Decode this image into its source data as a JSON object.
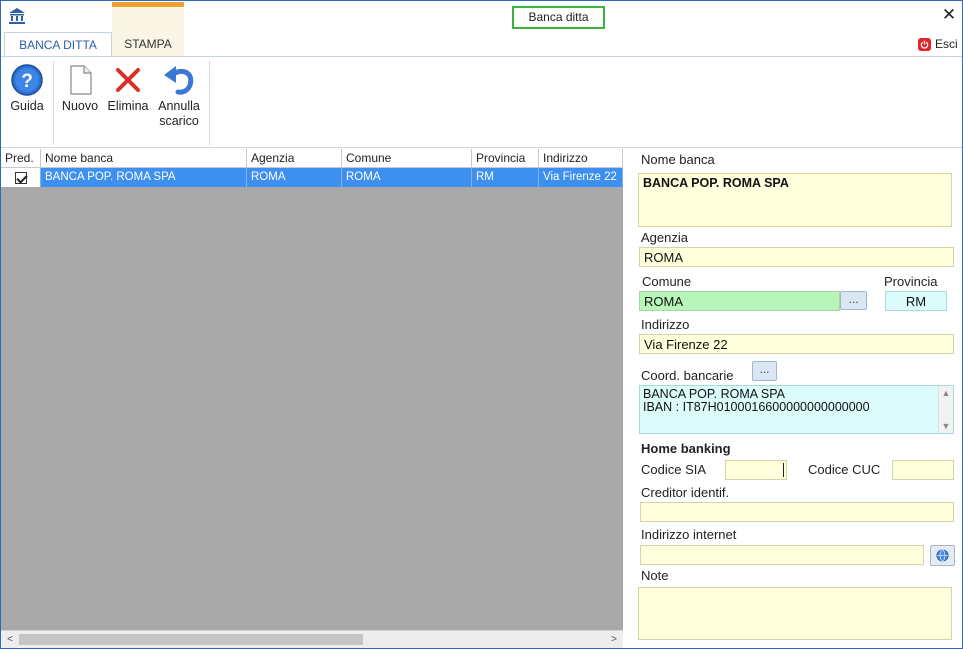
{
  "window": {
    "title": "Banca ditta",
    "close_glyph": "✕",
    "app_icon": "bank-icon"
  },
  "tabs": [
    {
      "label": "BANCA DITTA",
      "active": true
    },
    {
      "label": "STAMPA",
      "active": false
    }
  ],
  "esci": {
    "label": "Esci",
    "icon": "power-icon"
  },
  "ribbon": {
    "buttons": [
      {
        "label": "Guida",
        "icon": "help-icon"
      },
      {
        "label": "Nuovo",
        "icon": "new-document-icon"
      },
      {
        "label": "Elimina",
        "icon": "delete-x-icon"
      },
      {
        "label_line1": "Annulla",
        "label_line2": "scarico",
        "icon": "undo-arrow-icon"
      }
    ]
  },
  "grid": {
    "columns": [
      "Pred.",
      "Nome banca",
      "Agenzia",
      "Comune",
      "Provincia",
      "Indirizzo"
    ],
    "rows": [
      {
        "pred": true,
        "nome": "BANCA POP. ROMA SPA",
        "agenzia": "ROMA",
        "comune": "ROMA",
        "provincia": "RM",
        "indirizzo": "Via Firenze 22"
      }
    ],
    "scroll_left": "<",
    "scroll_right": ">"
  },
  "form": {
    "nome_banca": {
      "label": "Nome banca",
      "value": "BANCA POP. ROMA SPA"
    },
    "agenzia": {
      "label": "Agenzia",
      "value": "ROMA"
    },
    "comune": {
      "label": "Comune",
      "value": "ROMA",
      "button": "..."
    },
    "provincia": {
      "label": "Provincia",
      "value": "RM"
    },
    "indirizzo": {
      "label": "Indirizzo",
      "value": "Via Firenze 22"
    },
    "coord": {
      "label": "Coord. bancarie",
      "button": "...",
      "line1": "BANCA POP. ROMA SPA",
      "line2": "IBAN : IT87H0100016600000000000000"
    },
    "home_banking": {
      "heading": "Home banking"
    },
    "codice_sia": {
      "label": "Codice SIA",
      "value": ""
    },
    "codice_cuc": {
      "label": "Codice CUC",
      "value": ""
    },
    "creditor": {
      "label": "Creditor identif.",
      "value": ""
    },
    "internet": {
      "label": "Indirizzo internet",
      "value": "",
      "button_icon": "globe-icon"
    },
    "note": {
      "label": "Note",
      "value": ""
    }
  },
  "colors": {
    "selection": "#3d8ff0",
    "field_yellow": "#ffffdd",
    "field_green": "#b8f5b8",
    "field_cyan": "#dcfcfc",
    "title_highlight": "#3cb43c",
    "stampa_accent": "#f0a030"
  }
}
